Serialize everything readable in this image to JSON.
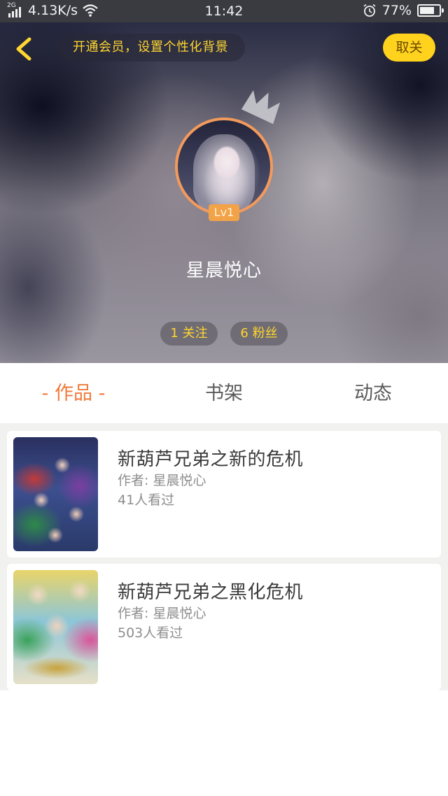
{
  "status_bar": {
    "network_type": "2G",
    "speed": "4.13K/s",
    "time": "11:42",
    "battery": "77%",
    "battery_level": 0.77,
    "icons": [
      "signal-icon",
      "wifi-icon",
      "alarm-icon",
      "battery-icon"
    ]
  },
  "header": {
    "back_icon": "chevron-left-icon",
    "vip_banner": "开通会员，设置个性化背景",
    "unfollow_label": "取关",
    "crown_icon": "crown-icon",
    "level": "Lv1",
    "username": "星晨悦心",
    "following": "1 关注",
    "fans": "6 粉丝"
  },
  "tabs": [
    {
      "label": "- 作品 -",
      "active": true
    },
    {
      "label": "书架",
      "active": false
    },
    {
      "label": "动态",
      "active": false
    }
  ],
  "works": [
    {
      "title": "新葫芦兄弟之新的危机",
      "author": "作者: 星晨悦心",
      "views": "41人看过"
    },
    {
      "title": "新葫芦兄弟之黑化危机",
      "author": "作者: 星晨悦心",
      "views": "503人看过"
    }
  ],
  "colors": {
    "accent_yellow": "#ffd630",
    "tab_active": "#f07a3a",
    "avatar_ring": "#f29a5c",
    "level_badge": "#f2a348"
  }
}
